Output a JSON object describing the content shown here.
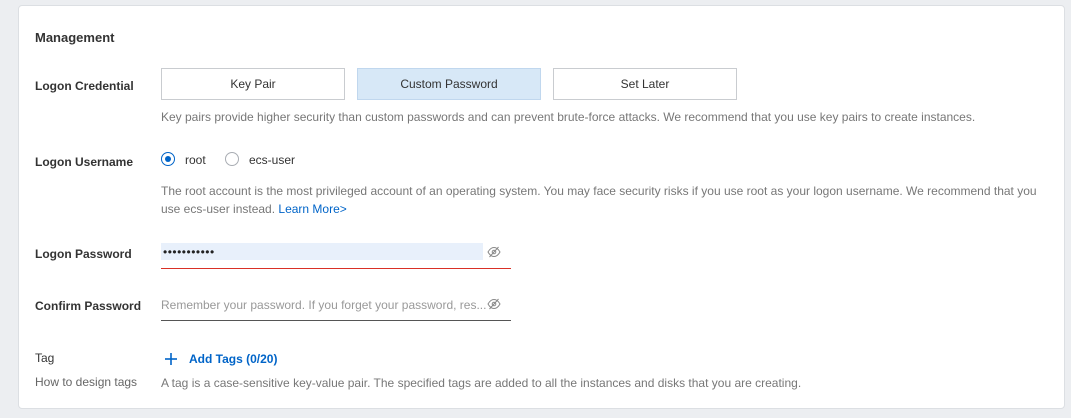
{
  "management": {
    "title": "Management"
  },
  "credential": {
    "label": "Logon Credential",
    "options": [
      "Key Pair",
      "Custom Password",
      "Set Later"
    ],
    "selected": "Custom Password",
    "help": "Key pairs provide higher security than custom passwords and can prevent brute-force attacks. We recommend that you use key pairs to create instances."
  },
  "username": {
    "label": "Logon Username",
    "options": [
      "root",
      "ecs-user"
    ],
    "selected": "root",
    "help": "The root account is the most privileged account of an operating system. You may face security risks if you use root as your logon username. We recommend that you use ecs-user instead.",
    "learn_more": "Learn More>"
  },
  "password": {
    "label": "Logon Password",
    "value": "•••••••••••",
    "eye_icon": "eye-hidden-icon"
  },
  "confirm": {
    "label": "Confirm Password",
    "placeholder": "Remember your password. If you forget your password, res...",
    "eye_icon": "eye-hidden-icon"
  },
  "tag": {
    "label": "Tag",
    "sublabel": "How to design tags",
    "add_label": "Add Tags (0/20)",
    "help": "A tag is a case-sensitive key-value pair. The specified tags are added to all the instances and disks that you are creating."
  },
  "colors": {
    "accent": "#0064c8",
    "selected_bg": "#d7e8f7",
    "error": "#d93026"
  }
}
